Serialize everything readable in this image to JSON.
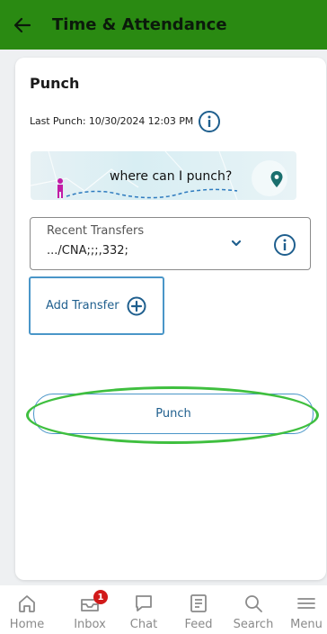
{
  "header": {
    "title": "Time & Attendance",
    "back_icon": "arrow-left-icon",
    "bg_color": "#2a8a12"
  },
  "card": {
    "title": "Punch",
    "last_punch": "Last Punch: 10/30/2024 12:03 PM"
  },
  "map_banner": {
    "text": "where can I punch?",
    "icon": "location-pin-icon"
  },
  "transfers": {
    "label": "Recent Transfers",
    "value": ".../CNA;;;,332;"
  },
  "add_transfer": {
    "label": "Add Transfer"
  },
  "punch_button": {
    "label": "Punch"
  },
  "bottom_nav": {
    "items": [
      {
        "label": "Home",
        "icon": "home-icon"
      },
      {
        "label": "Inbox",
        "icon": "inbox-icon",
        "badge": "1"
      },
      {
        "label": "Chat",
        "icon": "chat-icon"
      },
      {
        "label": "Feed",
        "icon": "feed-icon"
      },
      {
        "label": "Search",
        "icon": "search-icon"
      },
      {
        "label": "Menu",
        "icon": "menu-icon"
      }
    ]
  },
  "colors": {
    "accent": "#1f5f8e",
    "highlight": "#3fbf3f",
    "badge": "#d11a1a"
  }
}
